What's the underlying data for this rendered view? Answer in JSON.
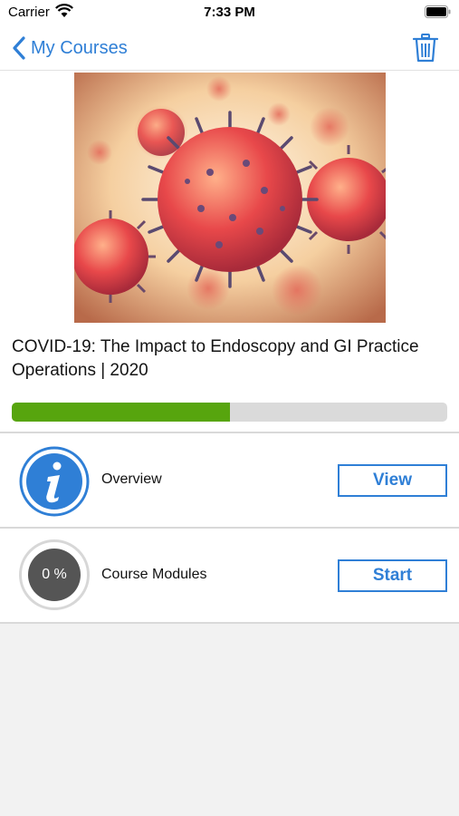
{
  "status_bar": {
    "carrier": "Carrier",
    "time": "7:33 PM"
  },
  "nav": {
    "back_label": "My Courses",
    "back_icon": "chevron-left-icon",
    "trash_icon": "trash-icon"
  },
  "colors": {
    "accent": "#2f7fd6",
    "progress": "#57a50e",
    "track": "#dadada"
  },
  "course": {
    "image": "covid-virus-illustration",
    "title": "COVID-19: The Impact to Endoscopy and GI Practice Operations | 2020",
    "progress_fraction": 0.5
  },
  "sections": [
    {
      "label": "Overview",
      "icon": "info-icon",
      "button_label": "View"
    },
    {
      "label": "Course Modules",
      "progress_text": "0 %",
      "button_label": "Start"
    }
  ]
}
